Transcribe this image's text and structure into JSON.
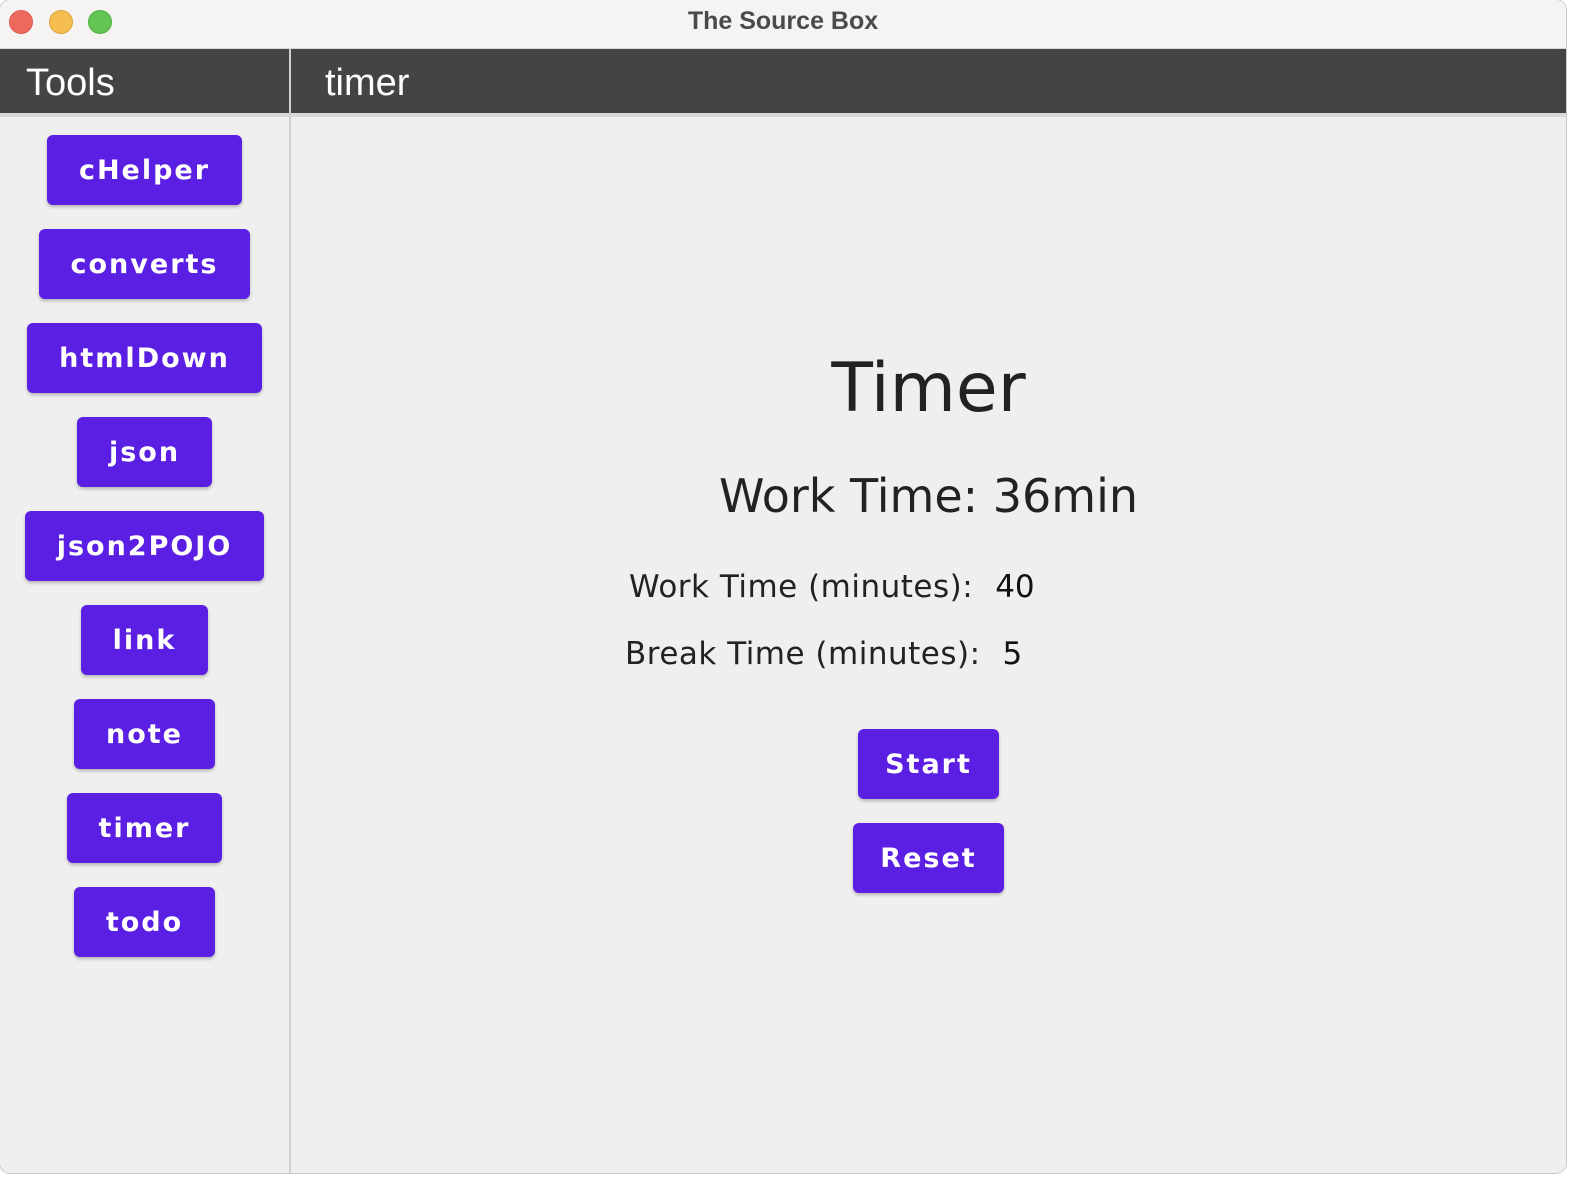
{
  "window": {
    "title": "The Source Box"
  },
  "sidebar": {
    "header": "Tools",
    "items": [
      {
        "label": "cHelper"
      },
      {
        "label": "converts"
      },
      {
        "label": "htmlDown"
      },
      {
        "label": "json"
      },
      {
        "label": "json2POJO"
      },
      {
        "label": "link"
      },
      {
        "label": "note"
      },
      {
        "label": "timer"
      },
      {
        "label": "todo"
      }
    ]
  },
  "main": {
    "header": "timer",
    "title": "Timer",
    "status": "Work Time: 36min",
    "work_field": {
      "label": "Work Time (minutes):",
      "value": "40"
    },
    "break_field": {
      "label": "Break Time (minutes):",
      "value": "5"
    },
    "start_label": "Start",
    "reset_label": "Reset"
  },
  "colors": {
    "accent": "#5a1fe3",
    "header_bg": "#444444",
    "background": "#efefef"
  }
}
